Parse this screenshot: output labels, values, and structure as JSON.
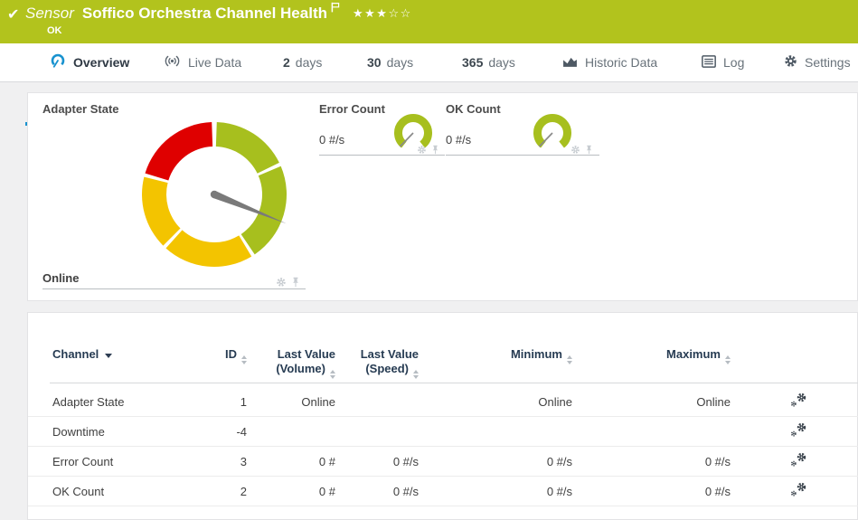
{
  "banner": {
    "check": "✔",
    "kind": "Sensor",
    "title": "Soffico Orchestra Channel Health",
    "status": "OK",
    "stars": {
      "filled": 3,
      "total": 5
    }
  },
  "tabs": {
    "overview": {
      "label": "Overview",
      "active": true
    },
    "live": {
      "label": "Live Data"
    },
    "d2": {
      "num": "2",
      "unit": "days"
    },
    "d30": {
      "num": "30",
      "unit": "days"
    },
    "d365": {
      "num": "365",
      "unit": "days"
    },
    "historic": {
      "label": "Historic Data"
    },
    "log": {
      "label": "Log"
    },
    "settings": {
      "label": "Settings"
    }
  },
  "overview": {
    "adapter": {
      "title": "Adapter State",
      "value": "Online",
      "gauge": {
        "segments": [
          {
            "from": 2,
            "to": 64,
            "color": "#a7bf1e"
          },
          {
            "from": 67,
            "to": 146,
            "color": "#a7bf1e"
          },
          {
            "from": 149,
            "to": 222,
            "color": "#f3c400"
          },
          {
            "from": 225,
            "to": 284,
            "color": "#f3c400"
          },
          {
            "from": 287,
            "to": 358,
            "color": "#df0000"
          }
        ],
        "needle_angle": 112
      }
    },
    "minis": [
      {
        "title": "Error Count",
        "value": "0 #/s",
        "arc_color": "#a7bf1e",
        "needle_angle": 224
      },
      {
        "title": "OK Count",
        "value": "0 #/s",
        "arc_color": "#a7bf1e",
        "needle_angle": 224
      }
    ]
  },
  "table": {
    "columns": [
      {
        "label": "Channel",
        "sort": "desc"
      },
      {
        "label": "ID",
        "sort": "both"
      },
      {
        "label": "Last Value (Volume)",
        "sort": "both"
      },
      {
        "label": "Last Value (Speed)",
        "sort": "both"
      },
      {
        "label": "Minimum",
        "sort": "both"
      },
      {
        "label": "Maximum",
        "sort": "both"
      }
    ],
    "rows": [
      {
        "channel": "Adapter State",
        "id": "1",
        "volume": "Online",
        "speed": "",
        "min": "Online",
        "max": "Online"
      },
      {
        "channel": "Downtime",
        "id": "-4",
        "volume": "",
        "speed": "",
        "min": "",
        "max": ""
      },
      {
        "channel": "Error Count",
        "id": "3",
        "volume": "0 #",
        "speed": "0 #/s",
        "min": "0 #/s",
        "max": "0 #/s"
      },
      {
        "channel": "OK Count",
        "id": "2",
        "volume": "0 #",
        "speed": "0 #/s",
        "min": "0 #/s",
        "max": "0 #/s"
      }
    ]
  },
  "colors": {
    "banner_green": "#b2c31d",
    "gauge_green": "#a7bf1e",
    "gauge_yellow": "#f3c400",
    "gauge_red": "#df0000",
    "accent_blue": "#1892cf",
    "needle_gray": "#7a7a7a"
  }
}
